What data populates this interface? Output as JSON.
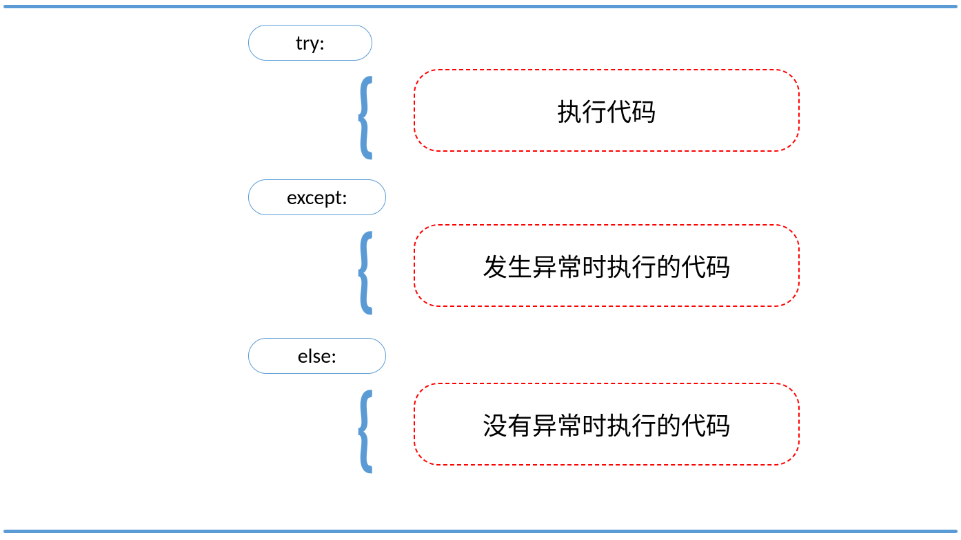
{
  "colors": {
    "accent_blue": "#5b9bd5",
    "dashed_red": "#ff0000"
  },
  "keywords": {
    "try": "try:",
    "except": "except:",
    "else": "else:"
  },
  "results": {
    "try": "执行代码",
    "except": "发生异常时执行的代码",
    "else": "没有异常时执行的代码"
  },
  "brace_glyph": "{"
}
